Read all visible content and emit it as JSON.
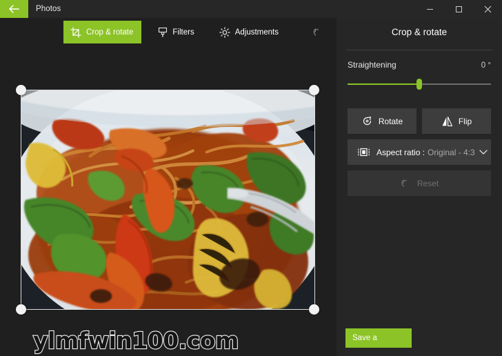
{
  "window": {
    "title": "Photos",
    "back_icon": "back-arrow-icon",
    "controls": [
      {
        "name": "minimize-button",
        "icon": "minimize-icon"
      },
      {
        "name": "maximize-button",
        "icon": "maximize-icon"
      },
      {
        "name": "close-button",
        "icon": "close-icon"
      }
    ]
  },
  "toolbar": {
    "crop_label": "Crop & rotate",
    "crop_icon": "crop-icon",
    "filters_label": "Filters",
    "filters_icon": "brush-icon",
    "adjustments_label": "Adjustments",
    "adjustments_icon": "brightness-icon",
    "undo_icon": "undo-icon",
    "redo_icon": "redo-icon",
    "active_accent": "#8cc327"
  },
  "canvas": {
    "image_alt": "stir-fried noodles with vegetables on a white plate",
    "crop_handles": [
      "top-left",
      "top-right",
      "bottom-left",
      "bottom-right"
    ]
  },
  "panel": {
    "title": "Crop & rotate",
    "straightening": {
      "label": "Straightening",
      "value": "0 °",
      "slider_percent": 50,
      "accent": "#8cc327"
    },
    "rotate": {
      "label": "Rotate",
      "icon": "rotate-icon"
    },
    "flip": {
      "label": "Flip",
      "icon": "flip-icon"
    },
    "aspect": {
      "label": "Aspect ratio :",
      "value": "Original - 4:3",
      "icon": "aspect-ratio-icon",
      "chevron": "chevron-down-icon"
    },
    "reset": {
      "label": "Reset",
      "icon": "reset-icon",
      "disabled": true
    }
  },
  "footer": {
    "save_label": "Save a",
    "watermark": "ylmfwin100.com"
  }
}
